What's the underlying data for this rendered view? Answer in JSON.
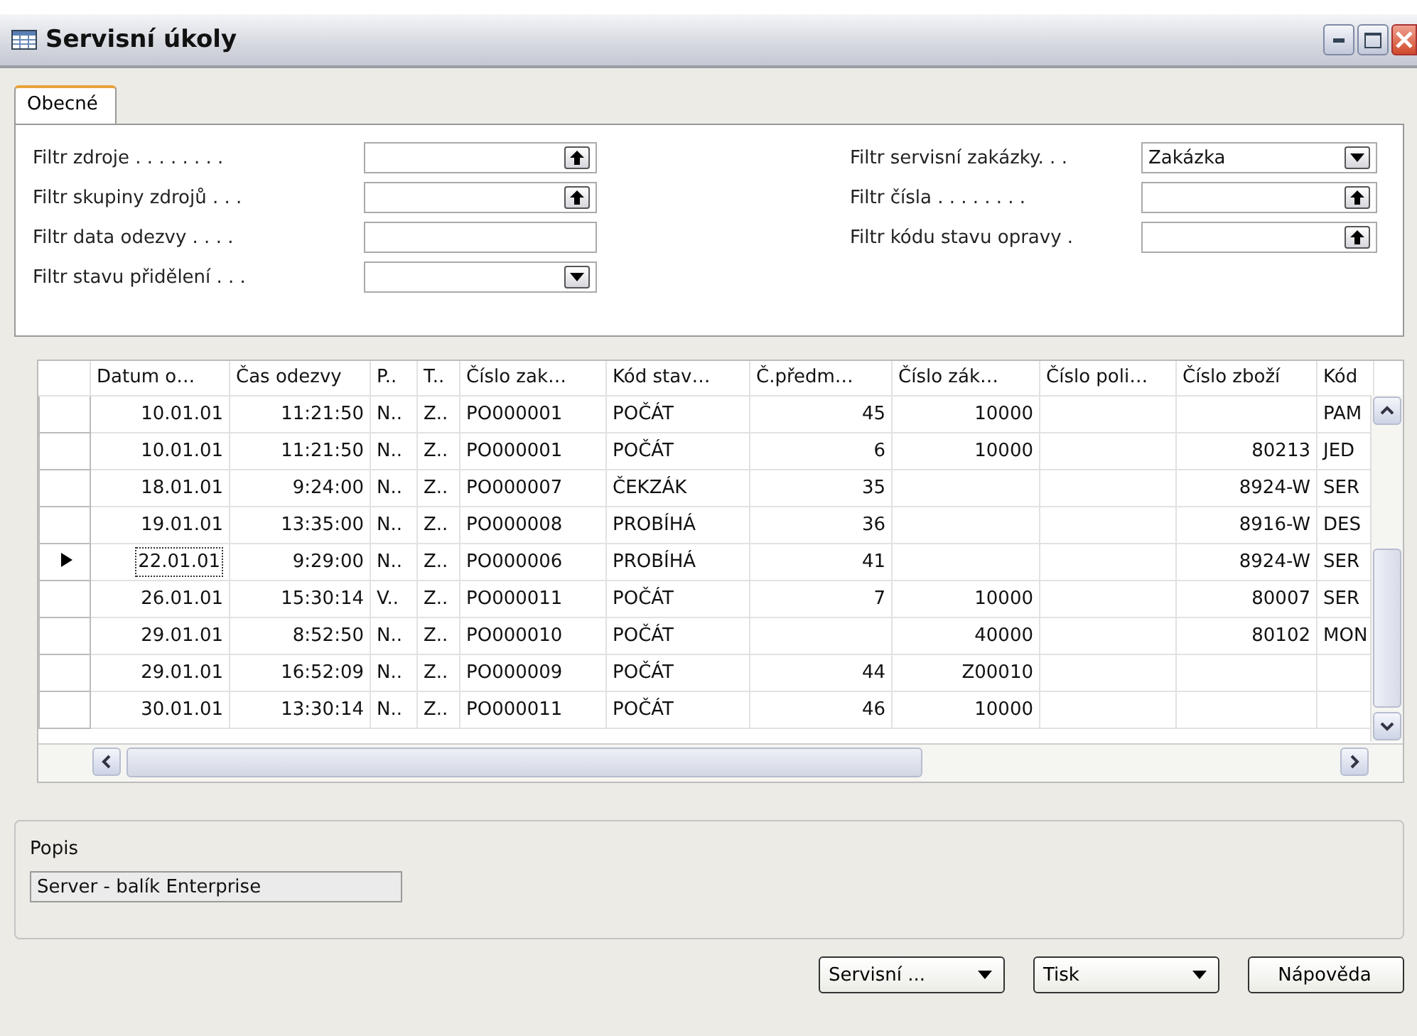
{
  "window": {
    "title": "Servisní úkoly"
  },
  "tabs": [
    {
      "label": "Obecné",
      "selected": true
    }
  ],
  "filters_left": [
    {
      "label": "Filtr zdroje . . . . . . . .",
      "kind": "lookup"
    },
    {
      "label": "Filtr skupiny zdrojů . . .",
      "kind": "lookup"
    },
    {
      "label": "Filtr data odezvy . . . .",
      "kind": "text"
    },
    {
      "label": "Filtr stavu přidělení . . .",
      "kind": "dropdown"
    }
  ],
  "filters_right": [
    {
      "label": "Filtr servisní zakázky. . .",
      "kind": "dropdown",
      "value": "Zakázka"
    },
    {
      "label": "Filtr čísla . . . . . . . .",
      "kind": "lookup"
    },
    {
      "label": "Filtr kódu stavu opravy  .",
      "kind": "lookup"
    }
  ],
  "table": {
    "columns": [
      "Datum o…",
      "Čas odezvy",
      "P..",
      "T..",
      "Číslo zak…",
      "Kód stav…",
      "Č.předm…",
      "Číslo zák…",
      "Číslo poli…",
      "Číslo zboží",
      "Kód"
    ],
    "rows": [
      {
        "selected": false,
        "cells": [
          "10.01.01",
          "11:21:50",
          "N..",
          "Z..",
          "PO000001",
          "POČÁT",
          "45",
          "10000",
          "",
          "",
          "PAM"
        ]
      },
      {
        "selected": false,
        "cells": [
          "10.01.01",
          "11:21:50",
          "N..",
          "Z..",
          "PO000001",
          "POČÁT",
          "6",
          "10000",
          "",
          "80213",
          "JED"
        ]
      },
      {
        "selected": false,
        "cells": [
          "18.01.01",
          "9:24:00",
          "N..",
          "Z..",
          "PO000007",
          "ČEKZÁK",
          "35",
          "",
          "",
          "8924-W",
          "SER"
        ]
      },
      {
        "selected": false,
        "cells": [
          "19.01.01",
          "13:35:00",
          "N..",
          "Z..",
          "PO000008",
          "PROBÍHÁ",
          "36",
          "",
          "",
          "8916-W",
          "DES"
        ]
      },
      {
        "selected": true,
        "cells": [
          "22.01.01",
          "9:29:00",
          "N..",
          "Z..",
          "PO000006",
          "PROBÍHÁ",
          "41",
          "",
          "",
          "8924-W",
          "SER"
        ]
      },
      {
        "selected": false,
        "cells": [
          "26.01.01",
          "15:30:14",
          "V..",
          "Z..",
          "PO000011",
          "POČÁT",
          "7",
          "10000",
          "",
          "80007",
          "SER"
        ]
      },
      {
        "selected": false,
        "cells": [
          "29.01.01",
          "8:52:50",
          "N..",
          "Z..",
          "PO000010",
          "POČÁT",
          "",
          "40000",
          "",
          "80102",
          "MON"
        ]
      },
      {
        "selected": false,
        "cells": [
          "29.01.01",
          "16:52:09",
          "N..",
          "Z..",
          "PO000009",
          "POČÁT",
          "44",
          "Z00010",
          "",
          "",
          ""
        ]
      },
      {
        "selected": false,
        "cells": [
          "30.01.01",
          "13:30:14",
          "N..",
          "Z..",
          "PO000011",
          "POČÁT",
          "46",
          "10000",
          "",
          "",
          ""
        ]
      }
    ]
  },
  "description": {
    "label": "Popis",
    "value": "Server - balík Enterprise"
  },
  "buttons": [
    {
      "label": "Servisní ...",
      "kind": "menu"
    },
    {
      "label": "Tisk",
      "kind": "menu"
    },
    {
      "label": "Nápověda",
      "kind": "plain"
    }
  ]
}
